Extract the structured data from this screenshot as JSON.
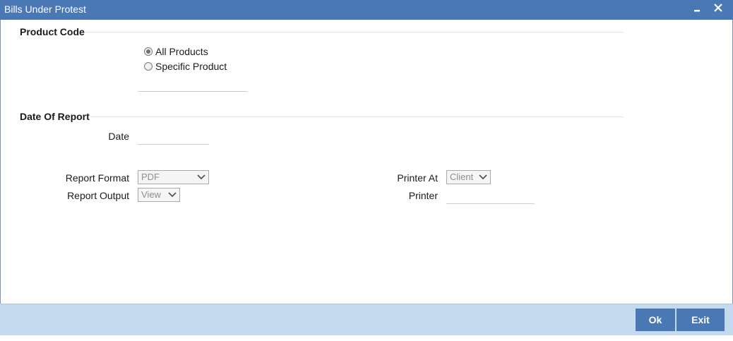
{
  "window": {
    "title": "Bills Under Protest",
    "minimize_icon": "minimize-icon",
    "close_icon": "close-icon"
  },
  "product_code": {
    "heading": "Product Code",
    "options": [
      {
        "label": "All Products",
        "checked": true
      },
      {
        "label": "Specific Product",
        "checked": false
      }
    ],
    "specific_product_value": ""
  },
  "date_of_report": {
    "heading": "Date Of Report",
    "date_label": "Date",
    "date_value": ""
  },
  "report": {
    "format_label": "Report Format",
    "format_value": "PDF",
    "output_label": "Report Output",
    "output_value": "View",
    "printer_at_label": "Printer At",
    "printer_at_value": "Client",
    "printer_label": "Printer",
    "printer_value": ""
  },
  "footer": {
    "ok_label": "Ok",
    "exit_label": "Exit"
  },
  "colors": {
    "titlebar": "#4a78b4",
    "footer": "#c3daef",
    "button": "#4a78b4"
  }
}
